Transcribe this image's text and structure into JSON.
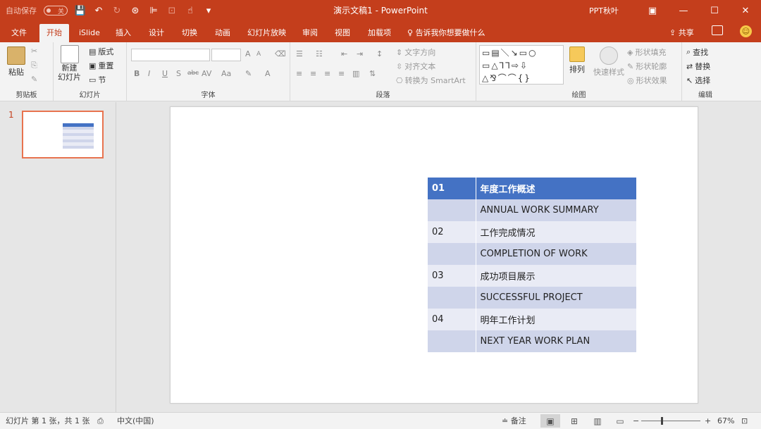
{
  "titlebar": {
    "autosave_label": "自动保存",
    "autosave_state": "关",
    "doc_title": "演示文稿1  -  PowerPoint",
    "user_name": "PPT秋叶",
    "min_glyph": "—",
    "max_glyph": "☐",
    "close_glyph": "✕",
    "options_glyph": "▣"
  },
  "menu": {
    "tabs": [
      "文件",
      "开始",
      "iSlide",
      "插入",
      "设计",
      "切换",
      "动画",
      "幻灯片放映",
      "审阅",
      "视图",
      "加载项"
    ],
    "tell_me": "告诉我你想要做什么",
    "share": "共享"
  },
  "ribbon": {
    "clipboard": {
      "paste": "粘贴",
      "label": "剪贴板"
    },
    "slides": {
      "new_slide_line1": "新建",
      "new_slide_line2": "幻灯片",
      "layout": "版式",
      "reset": "重置",
      "section": "节",
      "label": "幻灯片"
    },
    "font": {
      "bold": "B",
      "italic": "I",
      "underline": "U",
      "strike": "S",
      "abc": "abc",
      "spacing": "AV",
      "case": "Aa",
      "grow": "A",
      "shrink": "A",
      "label": "字体"
    },
    "paragraph": {
      "text_dir": "文字方向",
      "align_text": "对齐文本",
      "smartart": "转换为 SmartArt",
      "label": "段落"
    },
    "drawing": {
      "arrange": "排列",
      "quick_styles": "快速样式",
      "shape_fill": "形状填充",
      "shape_outline": "形状轮廓",
      "shape_effects": "形状效果",
      "label": "绘图",
      "shapes_row1": "▭▤＼↘▭○",
      "shapes_row2": "▭△⅂⅂⇨⇩",
      "shapes_row3": "△⅋⌒⌒{}"
    },
    "editing": {
      "find": "查找",
      "replace": "替换",
      "select": "选择",
      "label": "编辑"
    }
  },
  "thumbs": {
    "slide_number": "1"
  },
  "slide_table": {
    "rows": [
      {
        "num": "01",
        "text": "年度工作概述",
        "style": "head"
      },
      {
        "num": "",
        "text": "ANNUAL WORK SUMMARY",
        "style": "odd"
      },
      {
        "num": "02",
        "text": "工作完成情况",
        "style": "even"
      },
      {
        "num": "",
        "text": "COMPLETION OF WORK",
        "style": "odd"
      },
      {
        "num": "03",
        "text": "成功项目展示",
        "style": "even"
      },
      {
        "num": "",
        "text": "SUCCESSFUL PROJECT",
        "style": "odd"
      },
      {
        "num": "04",
        "text": "明年工作计划",
        "style": "even"
      },
      {
        "num": "",
        "text": "NEXT YEAR WORK PLAN",
        "style": "odd"
      }
    ],
    "header_color": "#4472c4",
    "band_dark": "#cfd5ea",
    "band_light": "#e9ebf5"
  },
  "statusbar": {
    "slide_info": "幻灯片 第 1 张，共 1 张",
    "language": "中文(中国)",
    "notes": "备注",
    "zoom_minus": "−",
    "zoom_plus": "+",
    "zoom_level": "67%"
  },
  "colors": {
    "accent": "#c43e1c",
    "ribbon_bg": "#f3f3f3",
    "thumb_border": "#e8734f"
  }
}
